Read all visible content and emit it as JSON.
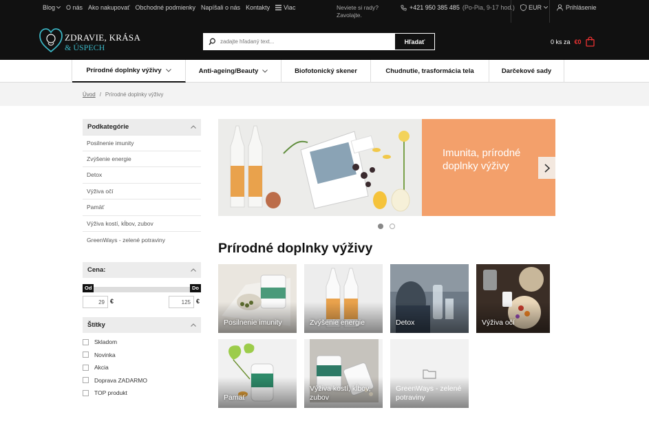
{
  "topbar": {
    "links": [
      "Blog",
      "O nás",
      "Ako nakupovať",
      "Obchodné podmienky",
      "Napíšali o nás",
      "Kontakty"
    ],
    "blog_label": "Blog",
    "more_label": "Viac",
    "help_line1": "Neviete si rady?",
    "help_line2": "Zavolajte.",
    "phone": "+421 950 385 485",
    "hours": "(Po-Pia, 9-17 hod.)",
    "currency": "EUR",
    "login": "Prihlásenie"
  },
  "header": {
    "logo_line1": "ZDRAVIE, KRÁSA",
    "logo_line2": "& ÚSPECH",
    "search_placeholder": "zadajte hľadaný text...",
    "search_button": "Hľadať",
    "cart_qty": "0 ks za",
    "cart_price": "€0"
  },
  "catnav": {
    "items": [
      {
        "label": "Prírodné doplnky výživy"
      },
      {
        "label": "Anti-ageing/Beauty"
      },
      {
        "label": "Biofotonický skener"
      },
      {
        "label": "Chudnutie, trasformácia tela"
      },
      {
        "label": "Darčekové sady"
      }
    ]
  },
  "breadcrumb": {
    "home": "Úvod",
    "separator": "/",
    "current": "Prírodné doplnky výživy"
  },
  "sidebar": {
    "subcat_title": "Podkategórie",
    "subcats": [
      "Posilnenie imunity",
      "Zvýšenie energie",
      "Detox",
      "Výživa očí",
      "Pamäť",
      "Výživa kostí, kĺbov, zubov",
      "GreenWays - zelené potraviny"
    ],
    "price_title": "Cena:",
    "price_from_label": "Od",
    "price_to_label": "Do",
    "price_min": "29",
    "price_max": "125",
    "price_currency": "€",
    "tags_title": "Štítky",
    "tags": [
      "Skladom",
      "Novinka",
      "Akcia",
      "Doprava ZADARMO",
      "TOP produkt"
    ]
  },
  "banner": {
    "text": "Imunita, prírodné doplnky výživy",
    "slides_total": 2,
    "active_slide": 1
  },
  "main": {
    "title": "Prírodné doplnky výživy",
    "tiles": [
      {
        "label": "Posilnenie imunity"
      },
      {
        "label": "Zvýšenie energie"
      },
      {
        "label": "Detox"
      },
      {
        "label": "Výživa očí"
      },
      {
        "label": "Pamäť"
      },
      {
        "label": "Výživa kostí, kĺbov, zubov"
      },
      {
        "label": "GreenWays - zelené potraviny"
      }
    ]
  },
  "colors": {
    "topbar_bg": "#111111",
    "banner_orange": "#f3a06b",
    "cart_price": "#e33333",
    "logo_accent": "#3bb5c4"
  }
}
